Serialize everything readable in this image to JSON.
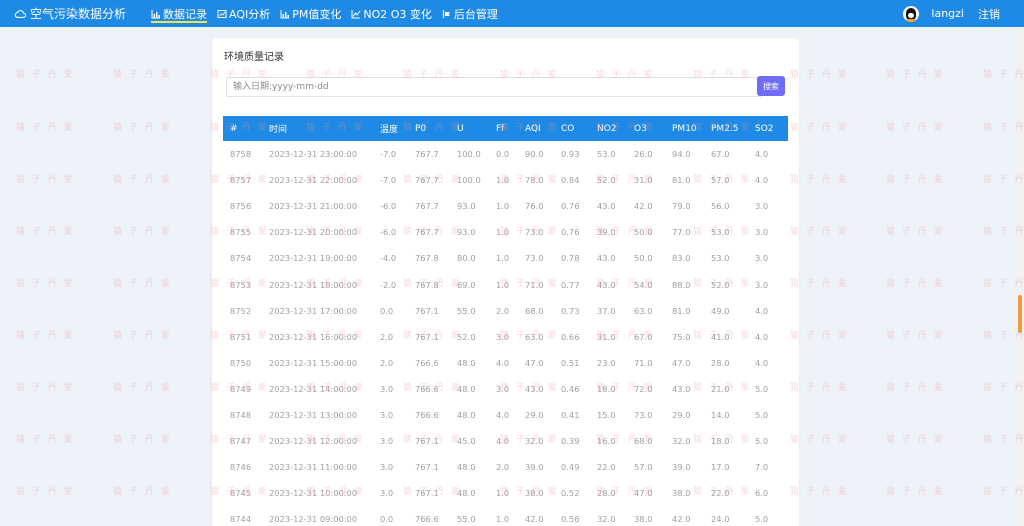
{
  "brand": {
    "title": "空气污染数据分析",
    "icon": "cloud-icon"
  },
  "nav": [
    {
      "label": "数据记录",
      "icon": "bar-chart-icon",
      "active": true
    },
    {
      "label": "AQI分析",
      "icon": "chart-box-icon",
      "active": false
    },
    {
      "label": "PM值变化",
      "icon": "bar-chart-icon",
      "active": false
    },
    {
      "label": "NO2 O3 变化",
      "icon": "line-chart-icon",
      "active": false
    },
    {
      "label": "后台管理",
      "icon": "admin-icon",
      "active": false
    }
  ],
  "user": {
    "name": "langzi",
    "logout": "注销",
    "avatar": "qq-penguin-icon"
  },
  "card": {
    "title": "环境质量记录"
  },
  "search": {
    "placeholder": "输入日期:yyyy-mm-dd",
    "button": "搜索"
  },
  "watermark": "猿 子 丹 爱",
  "colors": {
    "primary": "#1e8ae6",
    "button": "#6f6cf5",
    "active_underline": "#f4e34a"
  },
  "table": {
    "headers": [
      "#",
      "时间",
      "温度",
      "P0",
      "U",
      "Ff",
      "AQI",
      "CO",
      "NO2",
      "O3",
      "PM10",
      "PM2.5",
      "SO2"
    ],
    "rows": [
      [
        "8758",
        "2023-12-31 23:00:00",
        "-7.0",
        "767.7",
        "100.0",
        "0.0",
        "90.0",
        "0.93",
        "53.0",
        "26.0",
        "94.0",
        "67.0",
        "4.0"
      ],
      [
        "8757",
        "2023-12-31 22:00:00",
        "-7.0",
        "767.7",
        "100.0",
        "1.0",
        "78.0",
        "0.84",
        "52.0",
        "31.0",
        "81.0",
        "57.0",
        "4.0"
      ],
      [
        "8756",
        "2023-12-31 21:00:00",
        "-6.0",
        "767.7",
        "93.0",
        "1.0",
        "76.0",
        "0.76",
        "43.0",
        "42.0",
        "79.0",
        "56.0",
        "3.0"
      ],
      [
        "8755",
        "2023-12-31 20:00:00",
        "-6.0",
        "767.7",
        "93.0",
        "1.0",
        "73.0",
        "0.76",
        "39.0",
        "50.0",
        "77.0",
        "53.0",
        "3.0"
      ],
      [
        "8754",
        "2023-12-31 19:00:00",
        "-4.0",
        "767.8",
        "80.0",
        "1.0",
        "73.0",
        "0.78",
        "43.0",
        "50.0",
        "83.0",
        "53.0",
        "3.0"
      ],
      [
        "8753",
        "2023-12-31 18:00:00",
        "-2.0",
        "767.8",
        "69.0",
        "1.0",
        "71.0",
        "0.77",
        "43.0",
        "54.0",
        "88.0",
        "52.0",
        "3.0"
      ],
      [
        "8752",
        "2023-12-31 17:00:00",
        "0.0",
        "767.1",
        "55.0",
        "2.0",
        "68.0",
        "0.73",
        "37.0",
        "63.0",
        "81.0",
        "49.0",
        "4.0"
      ],
      [
        "8751",
        "2023-12-31 16:00:00",
        "2.0",
        "767.1",
        "52.0",
        "3.0",
        "63.0",
        "0.66",
        "31.0",
        "67.0",
        "75.0",
        "41.0",
        "4.0"
      ],
      [
        "8750",
        "2023-12-31 15:00:00",
        "2.0",
        "766.6",
        "48.0",
        "4.0",
        "47.0",
        "0.51",
        "23.0",
        "71.0",
        "47.0",
        "28.0",
        "4.0"
      ],
      [
        "8749",
        "2023-12-31 14:00:00",
        "3.0",
        "766.6",
        "48.0",
        "3.0",
        "43.0",
        "0.46",
        "18.0",
        "72.0",
        "43.0",
        "21.0",
        "5.0"
      ],
      [
        "8748",
        "2023-12-31 13:00:00",
        "3.0",
        "766.6",
        "48.0",
        "4.0",
        "29.0",
        "0.41",
        "15.0",
        "73.0",
        "29.0",
        "14.0",
        "5.0"
      ],
      [
        "8747",
        "2023-12-31 12:00:00",
        "3.0",
        "767.1",
        "45.0",
        "4.0",
        "32.0",
        "0.39",
        "16.0",
        "68.0",
        "32.0",
        "18.0",
        "5.0"
      ],
      [
        "8746",
        "2023-12-31 11:00:00",
        "3.0",
        "767.1",
        "48.0",
        "2.0",
        "39.0",
        "0.49",
        "22.0",
        "57.0",
        "39.0",
        "17.0",
        "7.0"
      ],
      [
        "8745",
        "2023-12-31 10:00:00",
        "3.0",
        "767.1",
        "48.0",
        "1.0",
        "38.0",
        "0.52",
        "28.0",
        "47.0",
        "38.0",
        "22.0",
        "6.0"
      ],
      [
        "8744",
        "2023-12-31 09:00:00",
        "0.0",
        "766.6",
        "55.0",
        "1.0",
        "42.0",
        "0.56",
        "32.0",
        "38.0",
        "42.0",
        "24.0",
        "5.0"
      ]
    ]
  }
}
